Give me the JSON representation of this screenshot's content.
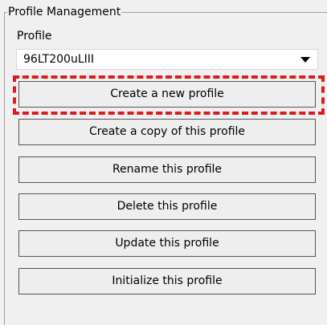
{
  "group": {
    "title": "Profile Management"
  },
  "profile": {
    "label": "Profile",
    "selected_value": "96LT200uLIII"
  },
  "buttons": {
    "create": "Create a new profile",
    "copy": "Create a copy of this profile",
    "rename": "Rename this profile",
    "delete": "Delete this profile",
    "update": "Update this profile",
    "initialize": "Initialize this profile"
  },
  "annotation": {
    "color": "#e01b1b"
  },
  "icons": {
    "dropdown": "chevron-down-icon"
  }
}
